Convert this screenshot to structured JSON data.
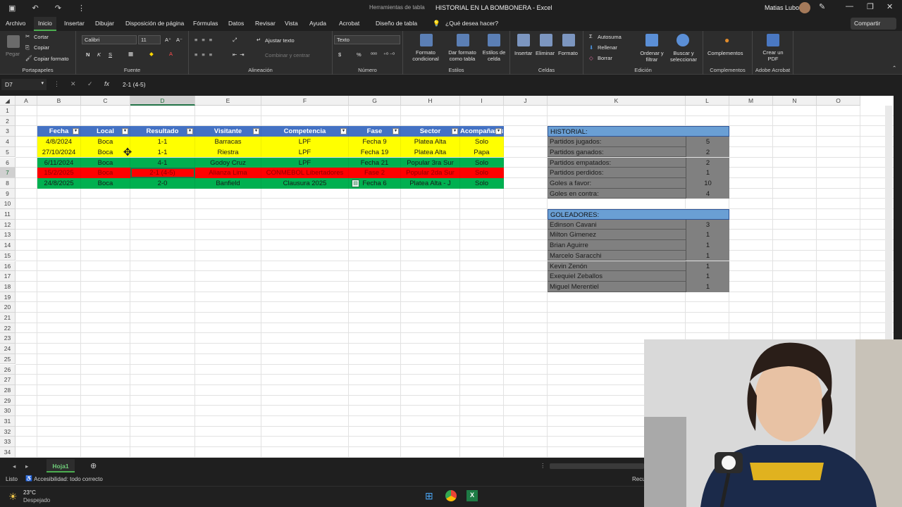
{
  "window": {
    "context_tab": "Herramientas de tabla",
    "doc_title": "HISTORIAL EN LA BOMBONERA  -  Excel",
    "user": "Matias Lubo"
  },
  "menu": {
    "items": [
      "Archivo",
      "Inicio",
      "Insertar",
      "Dibujar",
      "Disposición de página",
      "Fórmulas",
      "Datos",
      "Revisar",
      "Vista",
      "Ayuda",
      "Acrobat",
      "Diseño de tabla"
    ],
    "search": "¿Qué desea hacer?",
    "share": "Compartir"
  },
  "ribbon": {
    "clipboard": {
      "paste": "Pegar",
      "cut": "Cortar",
      "copy": "Copiar",
      "format_painter": "Copiar formato",
      "label": "Portapapeles"
    },
    "font": {
      "name": "Calibri",
      "size": "11",
      "bold": "N",
      "italic": "K",
      "underline": "S",
      "label": "Fuente"
    },
    "alignment": {
      "wrap": "Ajustar texto",
      "merge": "Combinar y centrar",
      "label": "Alineación"
    },
    "number": {
      "format": "Texto",
      "currency": "$",
      "percent": "%",
      "label": "Número"
    },
    "styles": {
      "conditional": "Formato condicional",
      "as_table": "Dar formato como tabla",
      "cell_styles": "Estilos de celda",
      "label": "Estilos"
    },
    "cells": {
      "insert": "Insertar",
      "delete": "Eliminar",
      "format": "Formato",
      "label": "Celdas"
    },
    "editing": {
      "autosum": "Autosuma",
      "fill": "Rellenar",
      "clear": "Borrar",
      "sort": "Ordenar y filtrar",
      "find": "Buscar y seleccionar",
      "label": "Edición"
    },
    "addins": {
      "button": "Complementos",
      "label": "Complementos"
    },
    "acrobat": {
      "button": "Crear un PDF",
      "label": "Adobe Acrobat"
    }
  },
  "formula_bar": {
    "name_box": "D7",
    "content": "2-1 (4-5)"
  },
  "columns": [
    "A",
    "B",
    "C",
    "D",
    "E",
    "F",
    "G",
    "H",
    "I",
    "J",
    "K",
    "L",
    "M",
    "N",
    "O"
  ],
  "rows": [
    "1",
    "2",
    "3",
    "4",
    "5",
    "6",
    "7",
    "8",
    "9",
    "10",
    "11",
    "12",
    "13",
    "14",
    "15",
    "16",
    "17",
    "18",
    "19",
    "20",
    "21",
    "22",
    "23",
    "24",
    "25",
    "26",
    "27",
    "28",
    "29",
    "30",
    "31",
    "32",
    "33",
    "34"
  ],
  "table": {
    "headers": [
      "Fecha",
      "Local",
      "Resultado",
      "Visitante",
      "Competencia",
      "Fase",
      "Sector",
      "Acompañante"
    ],
    "rows": [
      {
        "color": "yellow",
        "cells": [
          "4/8/2024",
          "Boca",
          "1-1",
          "Barracas",
          "LPF",
          "Fecha 9",
          "Platea Alta",
          "Solo"
        ]
      },
      {
        "color": "yellow",
        "cells": [
          "27/10/2024",
          "Boca",
          "1-1",
          "Riestra",
          "LPF",
          "Fecha 19",
          "Platea Alta",
          "Papa"
        ]
      },
      {
        "color": "green",
        "cells": [
          "6/11/2024",
          "Boca",
          "4-1",
          "Godoy Cruz",
          "LPF",
          "Fecha 21",
          "Popular 3ra Sur",
          "Solo"
        ]
      },
      {
        "color": "red",
        "cells": [
          "15/2/2025",
          "Boca",
          "2-1 (4-5)",
          "Alianza Lima",
          "CONMEBOL Libertadores",
          "Fase 2",
          "Popular 2da Sur",
          "Solo"
        ]
      },
      {
        "color": "green",
        "cells": [
          "24/8/2025",
          "Boca",
          "2-0",
          "Banfield",
          "Clausura 2025",
          "Fecha 6",
          "Platea Alta - J",
          "Solo"
        ]
      }
    ]
  },
  "historial": {
    "title": "HISTORIAL:",
    "items": [
      {
        "label": "Partidos jugados:",
        "value": "5"
      },
      {
        "label": "Partidos ganados:",
        "value": "2"
      },
      {
        "label": "Partidos empatados:",
        "value": "2"
      },
      {
        "label": "Partidos perdidos:",
        "value": "1"
      },
      {
        "label": "Goles a favor:",
        "value": "10"
      },
      {
        "label": "Goles en contra:",
        "value": "4"
      }
    ]
  },
  "goleadores": {
    "title": "GOLEADORES:",
    "items": [
      {
        "label": "Edinson Cavani",
        "value": "3"
      },
      {
        "label": "Milton Gimenez",
        "value": "1"
      },
      {
        "label": "Brian Aguirre",
        "value": "1"
      },
      {
        "label": "Marcelo Saracchi",
        "value": "1"
      },
      {
        "label": "Kevin Zenón",
        "value": "1"
      },
      {
        "label": "Exequiel Zeballos",
        "value": "1"
      },
      {
        "label": "Miguel Merentiel",
        "value": "1"
      }
    ]
  },
  "sheet": {
    "tab": "Hoja1"
  },
  "status": {
    "ready": "Listo",
    "accessibility": "Accesibilidad: todo correcto",
    "right": "Recu"
  },
  "taskbar": {
    "temp": "23°C",
    "weather": "Despejado"
  },
  "colors": {
    "header_blue": "#4472c4",
    "yellow": "#ffff00",
    "green": "#00b050",
    "red": "#ff0000",
    "panel_gray": "#808080",
    "panel_header": "#6a9fd4"
  }
}
